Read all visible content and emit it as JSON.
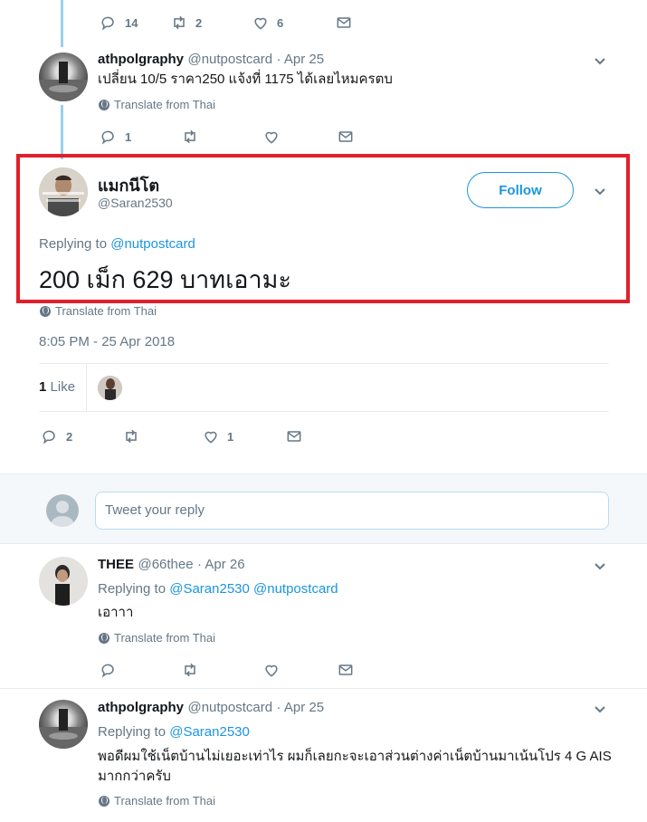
{
  "tweet_top_actions": {
    "replies": "14",
    "retweets": "2",
    "likes": "6"
  },
  "reply1": {
    "name": "athpolgraphy",
    "handle": "@nutpostcard",
    "date": "· Apr 25",
    "text": "เปลี่ยน 10/5 ราคา250 แจ้งที่ 1175 ได้เลยไหมครตบ",
    "translate": "Translate from Thai",
    "replies": "1"
  },
  "main": {
    "name": "แมกนีโต",
    "handle": "@Saran2530",
    "follow_label": "Follow",
    "replying_prefix": "Replying to",
    "replying_to": "@nutpostcard",
    "text": "200 เม็ก 629 บาทเอามะ",
    "translate": "Translate from Thai",
    "timestamp": "8:05 PM - 25 Apr 2018",
    "likes_count": "1",
    "likes_label": "Like",
    "replies": "2",
    "like_action": "1"
  },
  "reply_box": {
    "placeholder": "Tweet your reply"
  },
  "reply2": {
    "name": "THEE",
    "handle": "@66thee",
    "date": "· Apr 26",
    "replying_prefix": "Replying to",
    "replying_to": "@Saran2530 @nutpostcard",
    "text": "เอาาา",
    "translate": "Translate from Thai"
  },
  "reply3": {
    "name": "athpolgraphy",
    "handle": "@nutpostcard",
    "date": "· Apr 25",
    "replying_prefix": "Replying to",
    "replying_to": "@Saran2530",
    "text_line1": "พอดีผมใช้เน็ตบ้านไม่เยอะเท่าไร  ผมก็เลยกะจะเอาส่วนต่างค่าเน็ตบ้านมาเน้นโปร 4 G AIS",
    "text_line2": "มากกว่าครับ",
    "translate": "Translate from Thai"
  },
  "colors": {
    "accent": "#1b95e0",
    "highlight": "#e0202b",
    "thread": "#9ad0ec"
  }
}
